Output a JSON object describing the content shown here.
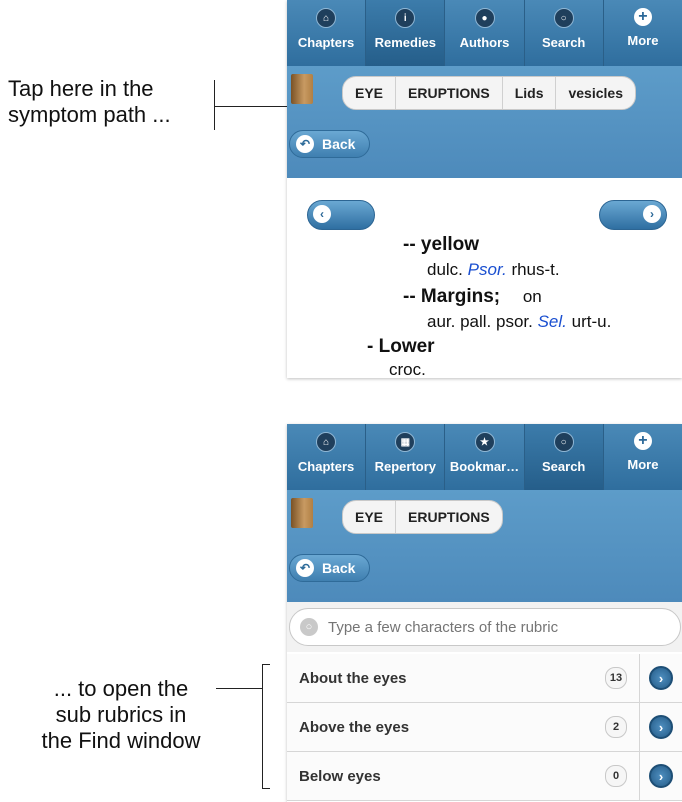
{
  "annotations": {
    "top_line1": "Tap here in the",
    "top_line2": "symptom path ...",
    "bottom_line1": "... to open the",
    "bottom_line2": "sub rubrics in",
    "bottom_line3": "the Find window"
  },
  "screen1": {
    "nav": [
      {
        "label": "Chapters",
        "icon": "home-icon",
        "glyph": "⌂"
      },
      {
        "label": "Remedies",
        "icon": "info-icon",
        "glyph": "i"
      },
      {
        "label": "Authors",
        "icon": "author-icon",
        "glyph": "●"
      },
      {
        "label": "Search",
        "icon": "search-icon",
        "glyph": "○"
      },
      {
        "label": "More",
        "icon": "plus-icon",
        "glyph": "+"
      }
    ],
    "crumbs": [
      "EYE",
      "ERUPTIONS",
      "Lids",
      "vesicles"
    ],
    "back_label": "Back",
    "rep": {
      "rubric1": "-- yellow",
      "rem1_a": "dulc.",
      "rem1_b": "Psor.",
      "rem1_c": "rhus-t.",
      "rubric2": "-- Margins;",
      "rubric2_suffix": "on",
      "rem2_a": "aur. pall. psor.",
      "rem2_b": "Sel.",
      "rem2_c": "urt-u.",
      "rubric3": "- Lower",
      "rem3": "croc."
    }
  },
  "screen2": {
    "nav": [
      {
        "label": "Chapters",
        "icon": "home-icon",
        "glyph": "⌂"
      },
      {
        "label": "Repertory",
        "icon": "grid-icon",
        "glyph": "▦"
      },
      {
        "label": "Bookmar…",
        "icon": "star-icon",
        "glyph": "★"
      },
      {
        "label": "Search",
        "icon": "search-icon",
        "glyph": "○"
      },
      {
        "label": "More",
        "icon": "plus-icon",
        "glyph": "+"
      }
    ],
    "crumbs": [
      "EYE",
      "ERUPTIONS"
    ],
    "back_label": "Back",
    "search_placeholder": "Type a few characters of the rubric",
    "items": [
      {
        "label": "About the eyes",
        "count": "13"
      },
      {
        "label": "Above the eyes",
        "count": "2"
      },
      {
        "label": "Below eyes",
        "count": "0"
      }
    ]
  },
  "colors": {
    "nav_bg": "#2f6e9e",
    "header_bg": "#5d9cc9",
    "link_blue": "#1a4fd0"
  }
}
